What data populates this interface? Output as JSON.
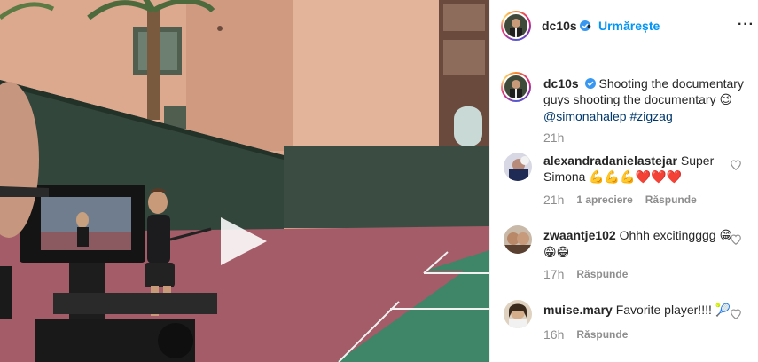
{
  "post": {
    "username": "dc10s",
    "follow_label": "Urmărește",
    "separator": "•",
    "more": "···",
    "caption_text": "Shooting the documentary guys shooting the documentary",
    "caption_emoji": "😉",
    "caption_mention": "@simonahalep",
    "caption_hashtag": "#zigzag",
    "caption_time": "21h"
  },
  "comments": [
    {
      "username": "alexandradanielastejar",
      "text": "Super Simona",
      "emoji": "💪💪💪❤️❤️❤️",
      "time": "21h",
      "likes": "1 apreciere",
      "reply": "Răspunde"
    },
    {
      "username": "zwaantje102",
      "text": "Ohhh excitingggg",
      "emoji": "😁😁😁",
      "time": "17h",
      "reply": "Răspunde"
    },
    {
      "username": "muise.mary",
      "text": "Favorite player!!!!",
      "emoji": "🎾",
      "time": "16h",
      "reply": "Răspunde"
    }
  ],
  "colors": {
    "link": "#0095f6",
    "verified": "#3897f0",
    "muted": "#8e8e8e"
  },
  "icons": [
    "verified-badge-icon",
    "more-options-icon",
    "play-icon",
    "heart-outline-icon"
  ]
}
